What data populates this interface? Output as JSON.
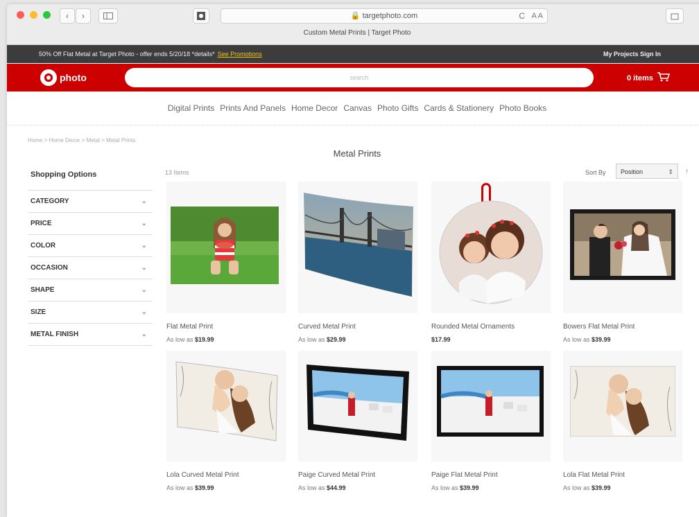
{
  "browser": {
    "url": "targetphoto.com",
    "tab_title": "Custom Metal Prints | Target Photo",
    "back_label": "‹",
    "forward_label": "›",
    "reload_glyph": "C",
    "text_size_label": "A A"
  },
  "promo": {
    "message": "50% Off Flat Metal at Target Photo - offer ends 5/20/18 *details*",
    "link": "See Promotions",
    "account": "My Projects   Sign In"
  },
  "header": {
    "logo_text": "photo",
    "search_placeholder": "search",
    "cart_label": "0 items"
  },
  "nav": [
    "Digital Prints",
    "Prints And Panels",
    "Home Decor",
    "Canvas",
    "Photo Gifts",
    "Cards & Stationery",
    "Photo Books"
  ],
  "breadcrumb": "Home  >  Home Decor  >  Metal  >  Metal Prints",
  "page_title": "Metal Prints",
  "sidebar": {
    "title": "Shopping Options",
    "filters": [
      "CATEGORY",
      "PRICE",
      "COLOR",
      "OCCASION",
      "SHAPE",
      "SIZE",
      "METAL FINISH"
    ]
  },
  "results": {
    "count": "13 Items",
    "sort_label": "Sort By",
    "sort_value": "Position"
  },
  "products": [
    {
      "name": "Flat Metal Print",
      "price_prefix": "As low as",
      "price": "$19.99"
    },
    {
      "name": "Curved Metal Print",
      "price_prefix": "As low as",
      "price": "$29.99"
    },
    {
      "name": "Rounded Metal Ornaments",
      "price_prefix": "",
      "price": "$17.99"
    },
    {
      "name": "Bowers Flat Metal Print",
      "price_prefix": "As low as",
      "price": "$39.99"
    },
    {
      "name": "Lola Curved Metal Print",
      "price_prefix": "As low as",
      "price": "$39.99"
    },
    {
      "name": "Paige Curved Metal Print",
      "price_prefix": "As low as",
      "price": "$44.99"
    },
    {
      "name": "Paige Flat Metal Print",
      "price_prefix": "As low as",
      "price": "$39.99"
    },
    {
      "name": "Lola Flat Metal Print",
      "price_prefix": "As low as",
      "price": "$39.99"
    }
  ]
}
